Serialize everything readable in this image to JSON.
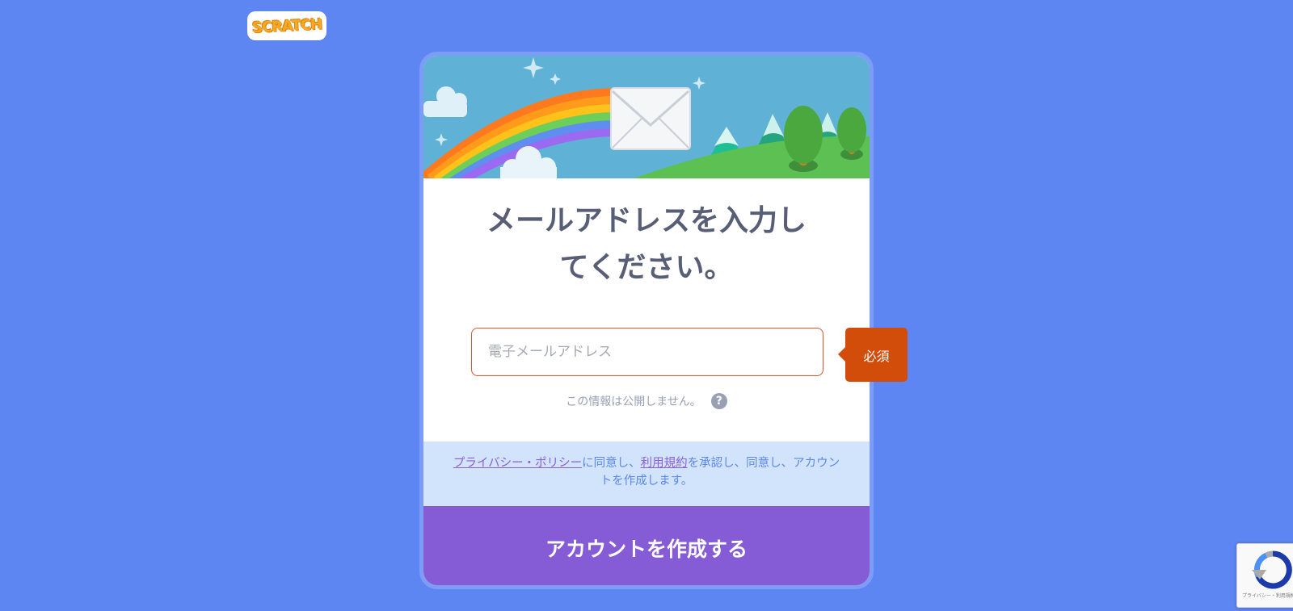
{
  "logo": {
    "text": "SCRATCH"
  },
  "form": {
    "title_line1": "メールアドレスを入力し",
    "title_line2": "てください。",
    "email_placeholder": "電子メールアドレス",
    "email_value": "",
    "privacy_hint": "この情報は公開しません。",
    "help_label": "?",
    "required_label": "必須"
  },
  "terms": {
    "privacy_link": "プライバシー・ポリシー",
    "text1": "に同意し、",
    "terms_link": "利用規約",
    "text2": "を承認し、同意し、アカウントを作成します。"
  },
  "cta": {
    "label": "アカウントを作成する"
  },
  "recaptcha": {
    "text": "プライバシー・利用規約"
  },
  "colors": {
    "background": "#5e86f2",
    "cta": "#855cd6",
    "required": "#d24d0a",
    "terms_bg": "#d2e4fb",
    "banner_sky": "#5fb2d6"
  },
  "icons": [
    "scratch-logo",
    "envelope-icon",
    "help-icon",
    "recaptcha-icon"
  ]
}
